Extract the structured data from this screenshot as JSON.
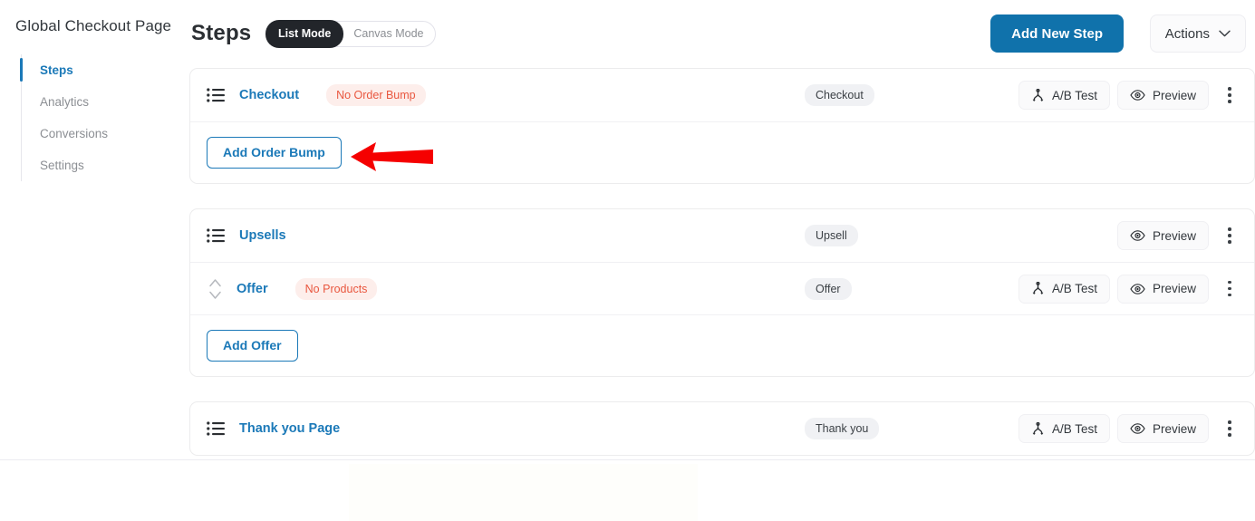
{
  "sidebar": {
    "title": "Global Checkout Page",
    "items": [
      {
        "label": "Steps",
        "active": true
      },
      {
        "label": "Analytics",
        "active": false
      },
      {
        "label": "Conversions",
        "active": false
      },
      {
        "label": "Settings",
        "active": false
      }
    ]
  },
  "header": {
    "heading": "Steps",
    "mode_toggle": {
      "options": [
        "List Mode",
        "Canvas Mode"
      ],
      "selected": "List Mode"
    },
    "add_new_step_label": "Add New Step",
    "actions_label": "Actions"
  },
  "colors": {
    "accent_blue": "#1b79b8",
    "primary_button": "#1072ab",
    "toggle_active": "#22252a",
    "warning_badge_bg": "#fdeeeb",
    "warning_badge_text": "#e9573f",
    "type_chip_bg": "#f0f1f4",
    "annotation_arrow": "#f50000"
  },
  "tool_labels": {
    "ab_test": "A/B Test",
    "preview": "Preview"
  },
  "cards": [
    {
      "rows": [
        {
          "icon": "list-icon",
          "name": "Checkout",
          "badge": "No Order Bump",
          "type_chip": "Checkout",
          "tools": [
            "A/B Test",
            "Preview"
          ],
          "kebab": true
        }
      ],
      "action_button": "Add Order Bump"
    },
    {
      "rows": [
        {
          "icon": "list-icon",
          "name": "Upsells",
          "badge": null,
          "type_chip": "Upsell",
          "tools": [
            "Preview"
          ],
          "kebab": true
        },
        {
          "icon": "sort-icon",
          "name": "Offer",
          "badge": "No Products",
          "type_chip": "Offer",
          "tools": [
            "A/B Test",
            "Preview"
          ],
          "kebab": true
        }
      ],
      "action_button": "Add Offer"
    },
    {
      "rows": [
        {
          "icon": "list-icon",
          "name": "Thank you Page",
          "badge": null,
          "type_chip": "Thank you",
          "tools": [
            "A/B Test",
            "Preview"
          ],
          "kebab": true
        }
      ],
      "action_button": null
    }
  ],
  "annotation": {
    "type": "arrow",
    "direction": "left",
    "points_at": "Add Order Bump"
  }
}
